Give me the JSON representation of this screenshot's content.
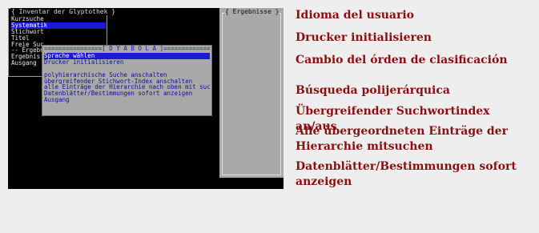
{
  "left_window": {
    "title": "{ Inventar der Glyptothek }",
    "items": [
      "Kurzsuche",
      "Systematik",
      "Stichwort",
      "Titel",
      "Freie Suc",
      "-- Ergebn",
      "Ergebnis",
      "Ausgang"
    ],
    "selected_index": 1
  },
  "right_window": {
    "title": "{ Ergebnisse }"
  },
  "popup": {
    "title": "================[ D Y A B O L A ]================",
    "items": [
      "Sprache wählen",
      "Drucker initialisieren",
      "",
      "polyhierarchische Suche anschalten",
      "übergreifender Stichwort-Index anschalten",
      "alle Einträge der Hierarchie nach oben mit suchen",
      "Datenblätter/Bestimmungen sofort anzeigen",
      "Ausgang"
    ],
    "selected_index": 0
  },
  "notes": [
    "Idioma del usuario",
    "Drucker initialisieren",
    "Cambio del órden de clasificación",
    "Búsqueda polijerárquica",
    "Übergreifender Suchwortindex an/aus",
    "Alle übergeordneten Einträge der Hierarchie mitsuchen",
    "Datenblätter/Bestimmungen sofort anzeigen"
  ],
  "colors": {
    "screen_bg": "#000000",
    "highlight": "#1c1ad6",
    "panel_gray": "#a9a9a9",
    "note_text": "#8b0f0f"
  }
}
